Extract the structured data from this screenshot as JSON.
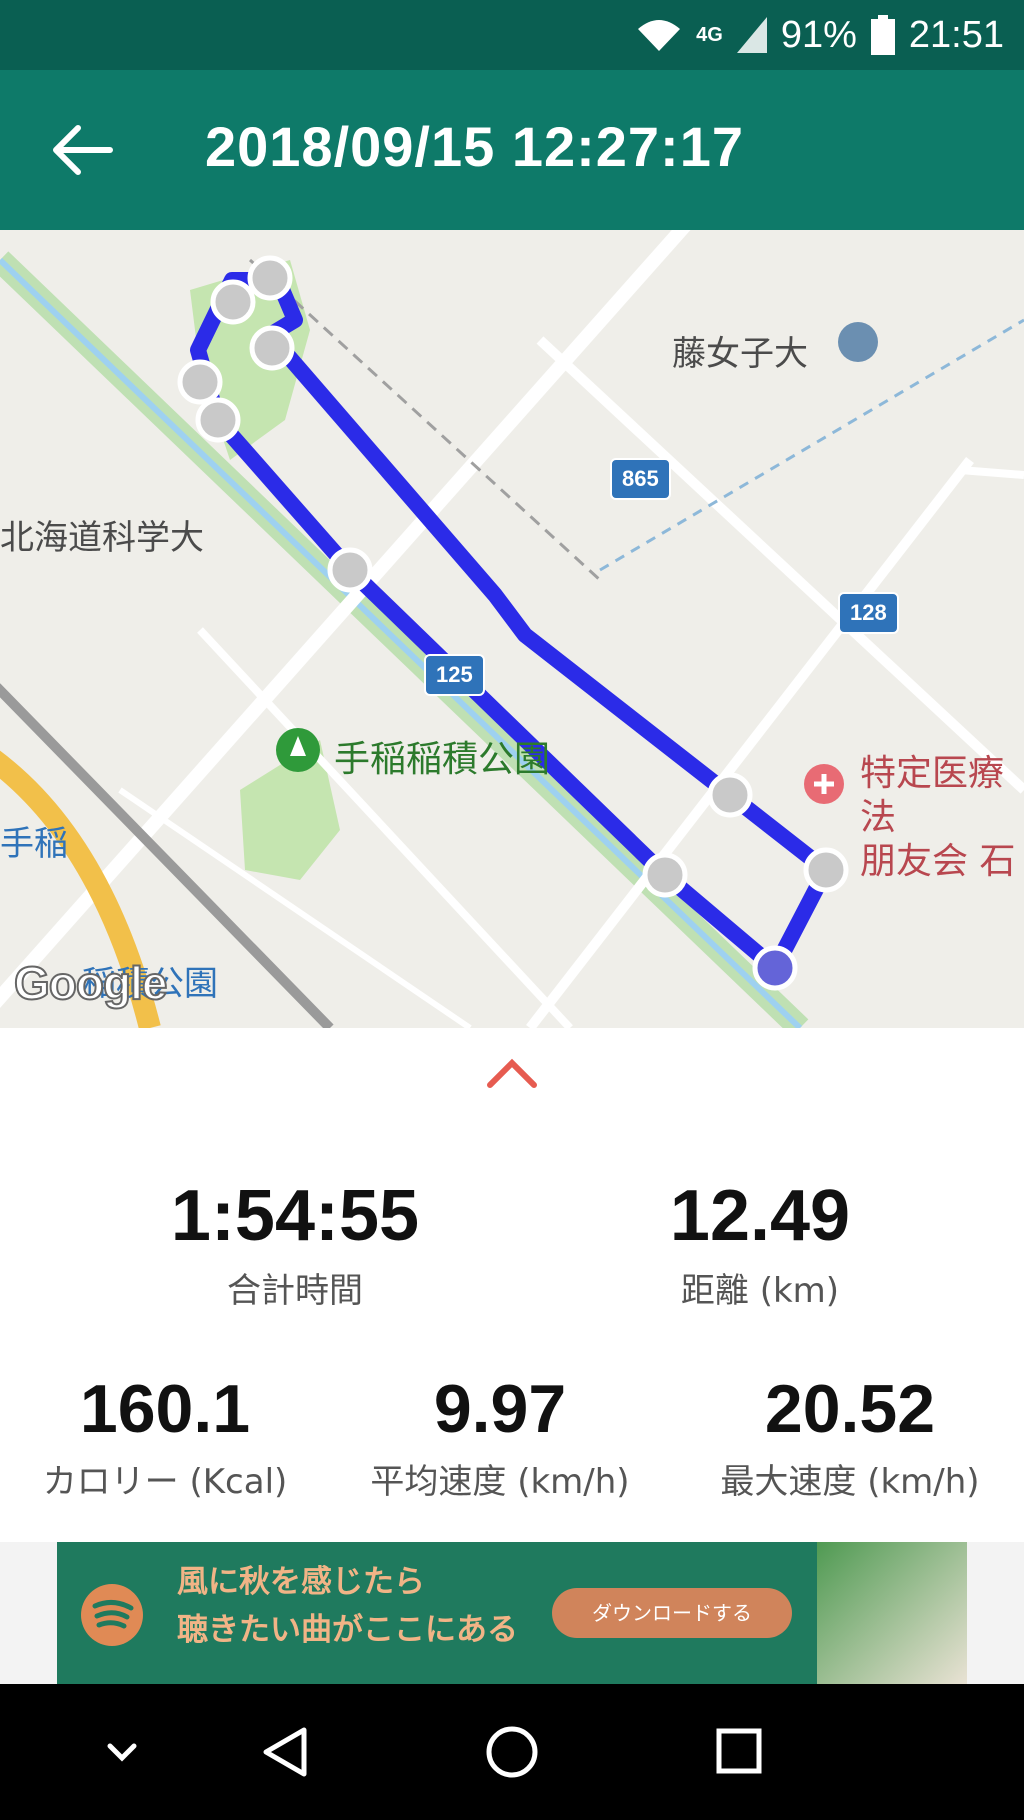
{
  "status_bar": {
    "network": "4G",
    "battery": "91%",
    "time": "21:51"
  },
  "header": {
    "title": "2018/09/15 12:27:17"
  },
  "map": {
    "labels": {
      "university": "藤女子大",
      "science_univ": "北海道科学大",
      "park": "手稲稲積公園",
      "hospital_line1": "特定医療法",
      "hospital_line2": "朋友会 石",
      "station_left": "手稲",
      "station_bottom": "稲積公園"
    },
    "routes": {
      "r865": "865",
      "r128": "128",
      "r125": "125"
    },
    "attribution": "Google"
  },
  "stats": {
    "total_time": {
      "value": "1:54:55",
      "label": "合計時間"
    },
    "distance": {
      "value": "12.49",
      "label": "距離 (km)"
    },
    "calories": {
      "value": "160.1",
      "label": "カロリー (Kcal)"
    },
    "avg_speed": {
      "value": "9.97",
      "label": "平均速度 (km/h)"
    },
    "max_speed": {
      "value": "20.52",
      "label": "最大速度 (km/h)"
    }
  },
  "ad": {
    "line1": "風に秋を感じたら",
    "line2": "聴きたい曲がここにある",
    "button": "ダウンロードする"
  }
}
